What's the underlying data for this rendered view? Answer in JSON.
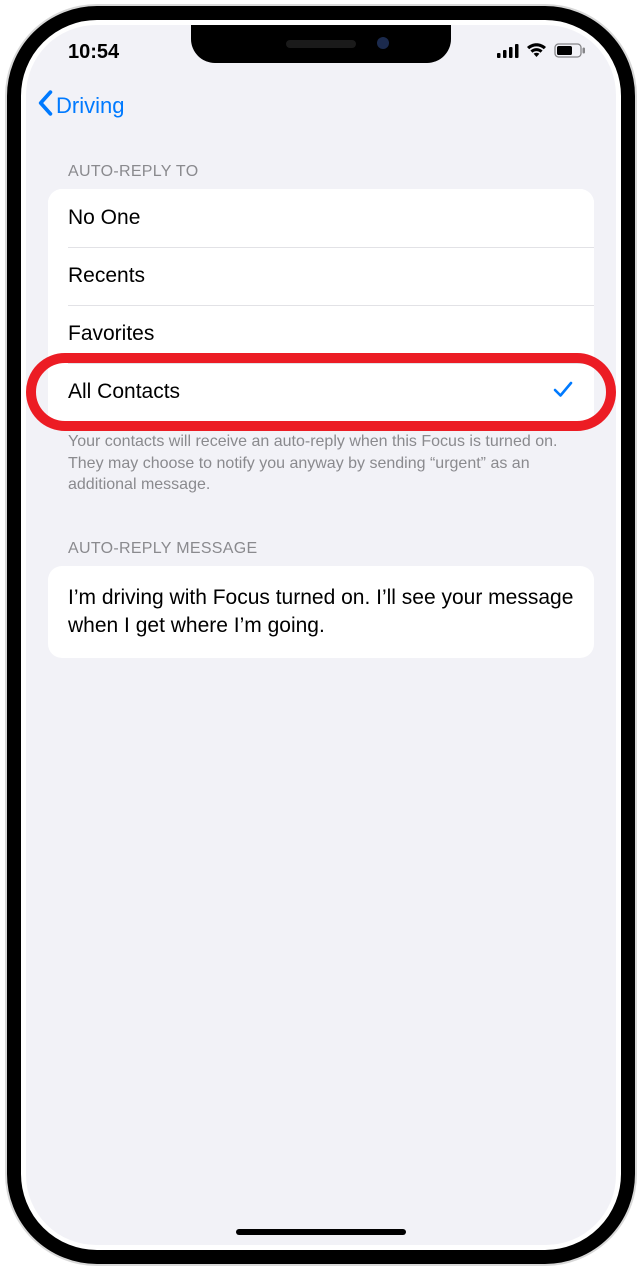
{
  "status_bar": {
    "time": "10:54"
  },
  "nav": {
    "back_label": "Driving"
  },
  "section1": {
    "header": "AUTO-REPLY TO",
    "options": [
      {
        "label": "No One",
        "selected": false
      },
      {
        "label": "Recents",
        "selected": false
      },
      {
        "label": "Favorites",
        "selected": false
      },
      {
        "label": "All Contacts",
        "selected": true
      }
    ],
    "footer": "Your contacts will receive an auto-reply when this Focus is turned on. They may choose to notify you anyway by sending “urgent” as an additional message."
  },
  "section2": {
    "header": "AUTO-REPLY MESSAGE",
    "message": "I’m driving with Focus turned on. I’ll see your message when I get where I’m going."
  },
  "highlight": {
    "target_option_index": 3
  }
}
